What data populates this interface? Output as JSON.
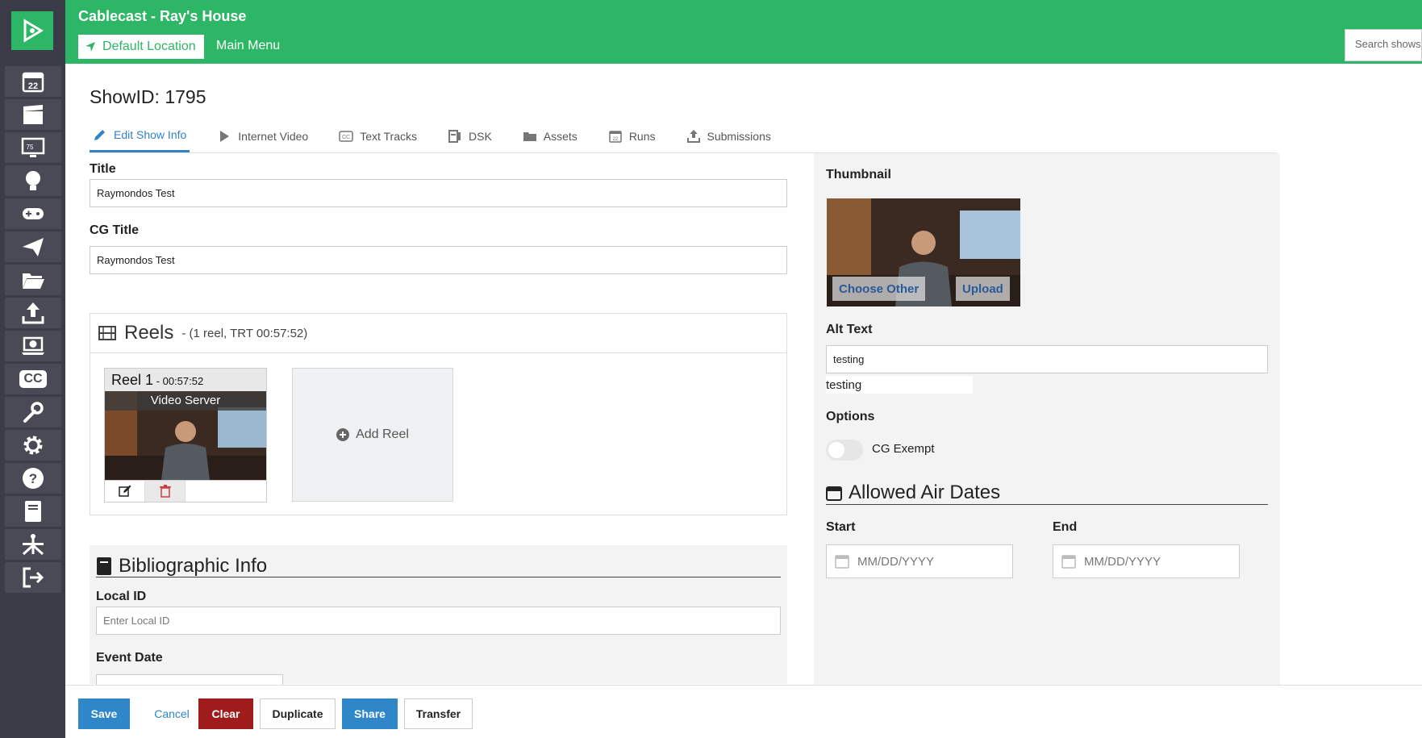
{
  "header": {
    "app_title": "Cablecast - Ray's House",
    "location_label": "Default Location",
    "main_menu_label": "Main Menu",
    "search_placeholder": "Search shows"
  },
  "sidebar": {
    "items": [
      {
        "icon": "calendar-icon",
        "text": "22"
      },
      {
        "icon": "clapperboard-icon"
      },
      {
        "icon": "monitor-channel-icon",
        "text": "75"
      },
      {
        "icon": "lightbulb-icon"
      },
      {
        "icon": "gamepad-icon"
      },
      {
        "icon": "paper-plane-icon"
      },
      {
        "icon": "folder-open-icon"
      },
      {
        "icon": "upload-icon"
      },
      {
        "icon": "laptop-play-icon"
      },
      {
        "icon": "closed-caption-icon",
        "text": "CC"
      },
      {
        "icon": "wrench-icon"
      },
      {
        "icon": "gear-icon"
      },
      {
        "icon": "help-icon"
      },
      {
        "icon": "book-icon"
      },
      {
        "icon": "network-icon"
      },
      {
        "icon": "sign-out-icon"
      }
    ]
  },
  "page": {
    "show_id": "ShowID: 1795"
  },
  "tabs": [
    {
      "label": "Edit Show Info",
      "icon": "pencil-icon",
      "active": true
    },
    {
      "label": "Internet Video",
      "icon": "play-icon"
    },
    {
      "label": "Text Tracks",
      "icon": "cc-icon"
    },
    {
      "label": "DSK",
      "icon": "dsk-icon"
    },
    {
      "label": "Assets",
      "icon": "folder-icon"
    },
    {
      "label": "Runs",
      "icon": "calendar-icon"
    },
    {
      "label": "Submissions",
      "icon": "upload-icon"
    }
  ],
  "form": {
    "title_label": "Title",
    "title_value": "Raymondos Test",
    "cg_title_label": "CG Title",
    "cg_title_value": "Raymondos Test"
  },
  "reels": {
    "title": "Reels",
    "summary": "- (1 reel, TRT 00:57:52)",
    "items": [
      {
        "name": "Reel 1",
        "duration": " - 00:57:52",
        "source": "Video Server"
      }
    ],
    "add_label": "Add Reel"
  },
  "biblio": {
    "title": "Bibliographic Info",
    "local_id_label": "Local ID",
    "local_id_placeholder": "Enter Local ID",
    "event_date_label": "Event Date"
  },
  "right": {
    "thumbnail_label": "Thumbnail",
    "choose_other": "Choose Other",
    "upload": "Upload",
    "alt_text_label": "Alt Text",
    "alt_text_value": "testing",
    "alt_text_preview": "testing",
    "options_label": "Options",
    "cg_exempt_label": "CG Exempt",
    "cg_exempt_on": false,
    "air_dates_title": "Allowed Air Dates",
    "start_label": "Start",
    "end_label": "End",
    "date_placeholder": "MM/DD/YYYY"
  },
  "footer": {
    "save": "Save",
    "cancel": "Cancel",
    "clear": "Clear",
    "duplicate": "Duplicate",
    "share": "Share",
    "transfer": "Transfer"
  },
  "colors": {
    "brand_green": "#2db665",
    "sidebar": "#3c3c48",
    "primary_blue": "#2f86c8",
    "danger_red": "#a01c1c"
  }
}
